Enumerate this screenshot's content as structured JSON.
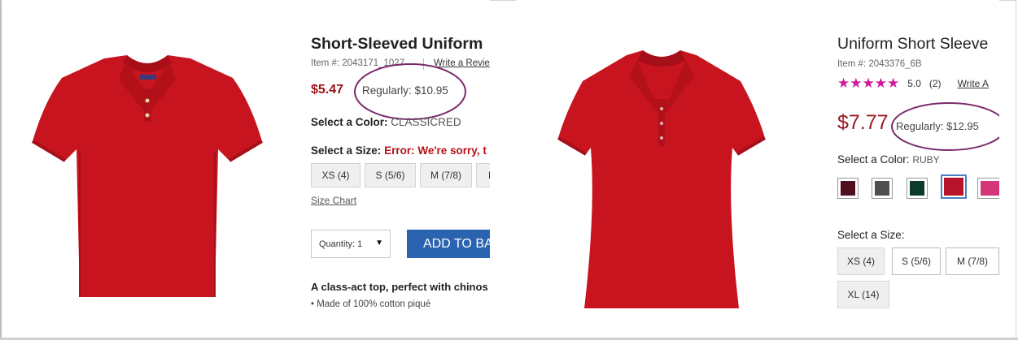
{
  "colors": {
    "sale_red": "#a0121c",
    "circle": "#7a2a6a",
    "add_btn": "#2a63b0",
    "star": "#d0189c",
    "shirt_red": "#c8141e"
  },
  "left": {
    "title": "Short-Sleeved Uniform",
    "item_number": "Item #: 2043171_1027",
    "write_review": "Write a Revie",
    "sale_price": "$5.47",
    "regular_price": "Regularly: $10.95",
    "color_label": "Select a Color:",
    "color_value": "CLASSICRED",
    "size_label": "Select a Size:",
    "size_error": "Error: We're sorry, t",
    "sizes": [
      "XS (4)",
      "S (5/6)",
      "M (7/8)",
      "L"
    ],
    "size_chart": "Size Chart",
    "quantity_label": "Quantity: 1",
    "add_to_bag": "ADD TO BA",
    "description": "A class-act top, perfect with chinos",
    "bullet": "Made of 100% cotton piqué"
  },
  "right": {
    "title": "Uniform Short Sleeve",
    "item_number": "Item #: 2043376_6B",
    "rating": "5.0",
    "review_count": "(2)",
    "write_review": "Write A",
    "sale_price": "$7.77",
    "regular_price": "Regularly: $12.95",
    "color_label": "Select a Color:",
    "color_value": "RUBY",
    "swatches": [
      {
        "name": "burgundy",
        "color": "#4f0f1e"
      },
      {
        "name": "gray",
        "color": "#4f4f4f"
      },
      {
        "name": "dark-green",
        "color": "#0c3a2c"
      },
      {
        "name": "ruby",
        "color": "#b5142a",
        "selected": true
      },
      {
        "name": "pink",
        "color": "#d3377a"
      }
    ],
    "size_label": "Select a Size:",
    "sizes": [
      "XS (4)",
      "S (5/6)",
      "M (7/8)",
      "XL (14)"
    ]
  }
}
